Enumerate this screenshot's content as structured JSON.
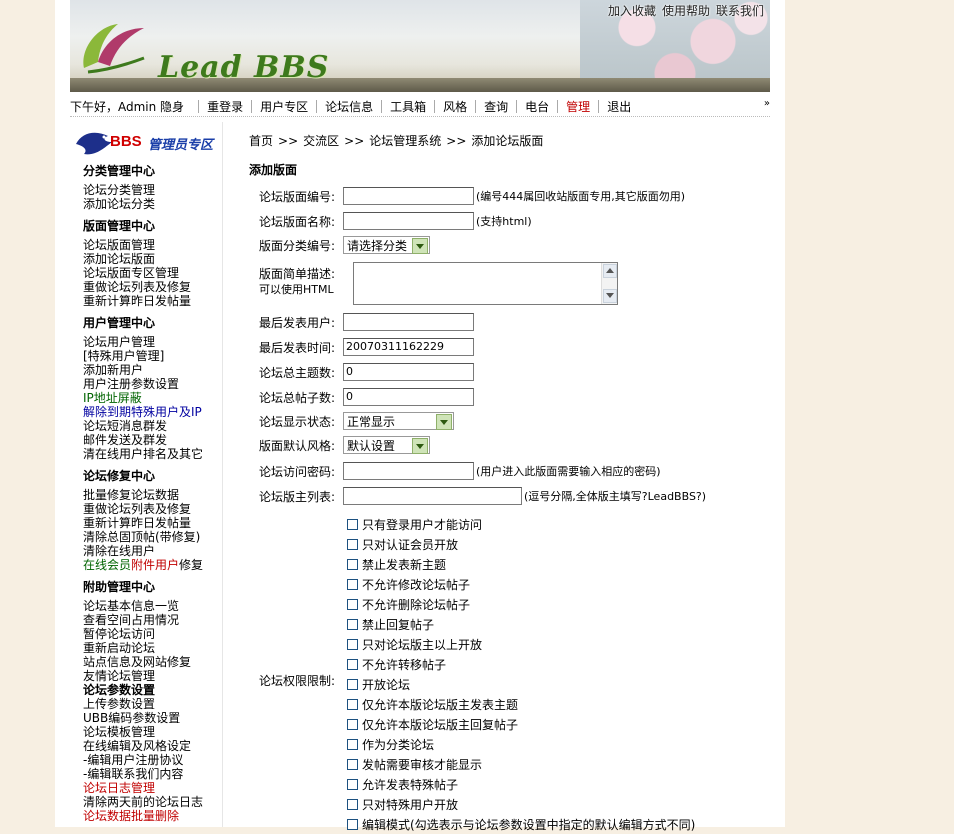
{
  "header": {
    "logo_text": "Lead BBS",
    "top_links": [
      "加入收藏",
      "使用帮助",
      "联系我们"
    ]
  },
  "nav": {
    "greeting": "下午好，Admin 隐身",
    "items": [
      "重登录",
      "用户专区",
      "论坛信息",
      "工具箱",
      "风格",
      "查询",
      "电台",
      "管理",
      "退出"
    ],
    "active": "管理",
    "more": "»"
  },
  "sidebar": {
    "logo_bbs": "BBS",
    "logo_zone": "管理员专区",
    "groups": [
      {
        "title": "分类管理中心",
        "links": [
          "论坛分类管理",
          "添加论坛分类"
        ]
      },
      {
        "title": "版面管理中心",
        "links": [
          "论坛版面管理",
          "添加论坛版面",
          "论坛版面专区管理",
          "重做论坛列表及修复",
          "重新计算昨日发帖量"
        ]
      },
      {
        "title": "用户管理中心",
        "links": [
          "论坛用户管理",
          "[特殊用户管理]",
          "添加新用户",
          "用户注册参数设置",
          "IP地址屏蔽",
          "解除到期特殊用户及IP",
          "论坛短消息群发",
          "邮件发送及群发",
          "清在线用户排名及其它"
        ]
      },
      {
        "title": "论坛修复中心",
        "links": [
          "批量修复论坛数据",
          "重做论坛列表及修复",
          "重新计算昨日发帖量",
          "清除总固顶帖(带修复)",
          "清除在线用户"
        ],
        "mixed_link": {
          "part1": "在线会员",
          "part2": "附件",
          "part3": "用户",
          "part4": "修复"
        }
      },
      {
        "title": "附助管理中心",
        "links": [
          "论坛基本信息一览",
          "查看空间占用情况",
          "暂停论坛访问",
          "重新启动论坛",
          "站点信息及网站修复",
          "友情论坛管理"
        ]
      },
      {
        "title": "",
        "links": [
          "论坛参数设置",
          "上传参数设置",
          "UBB编码参数设置",
          "论坛模板管理",
          "在线编辑及风格设定",
          " -编辑用户注册协议",
          " -编辑联系我们内容",
          "论坛日志管理",
          "清除两天前的论坛日志",
          "论坛数据批量删除"
        ]
      }
    ]
  },
  "main": {
    "breadcrumb": [
      "首页",
      "交流区",
      "论坛管理系统",
      "添加论坛版面"
    ],
    "breadcrumb_sep": ">>",
    "form_title": "添加版面",
    "fields": {
      "board_id": {
        "label": "论坛版面编号:",
        "value": "",
        "hint": "(编号444属回收站版面专用,其它版面勿用)"
      },
      "board_name": {
        "label": "论坛版面名称:",
        "value": "",
        "hint": "(支持html)"
      },
      "category_id": {
        "label": "版面分类编号:",
        "value": "请选择分类"
      },
      "description": {
        "label1": "版面简单描述:",
        "label2": "可以使用HTML",
        "value": ""
      },
      "last_user": {
        "label": "最后发表用户:",
        "value": ""
      },
      "last_time": {
        "label": "最后发表时间:",
        "value": "20070311162229"
      },
      "topic_count": {
        "label": "论坛总主题数:",
        "value": "0"
      },
      "post_count": {
        "label": "论坛总帖子数:",
        "value": "0"
      },
      "display_state": {
        "label": "论坛显示状态:",
        "value": "正常显示"
      },
      "default_style": {
        "label": "版面默认风格:",
        "value": "默认设置"
      },
      "password": {
        "label": "论坛访问密码:",
        "value": "",
        "hint": "(用户进入此版面需要输入相应的密码)"
      },
      "masters": {
        "label": "论坛版主列表:",
        "value": "",
        "hint": "(逗号分隔,全体版主填写?LeadBBS?)"
      }
    },
    "permissions_label": "论坛权限限制:",
    "permissions": [
      "只有登录用户才能访问",
      "只对认证会员开放",
      "禁止发表新主题",
      "不允许修改论坛帖子",
      "不允许删除论坛帖子",
      "禁止回复帖子",
      "只对论坛版主以上开放",
      "不允许转移帖子",
      "开放论坛",
      "仅允许本版论坛版主发表主题",
      "仅允许本版论坛版主回复帖子",
      "作为分类论坛",
      "发帖需要审核才能显示",
      "允许发表特殊帖子",
      "只对特殊用户开放",
      "编辑模式(勾选表示与论坛参数设置中指定的默认编辑方式不同)"
    ]
  },
  "colors": {
    "page_bg": "#f7efe2",
    "active_nav": "#c00000",
    "link_green": "#006400",
    "link_blue": "#0000a0",
    "link_red": "#c00000"
  }
}
